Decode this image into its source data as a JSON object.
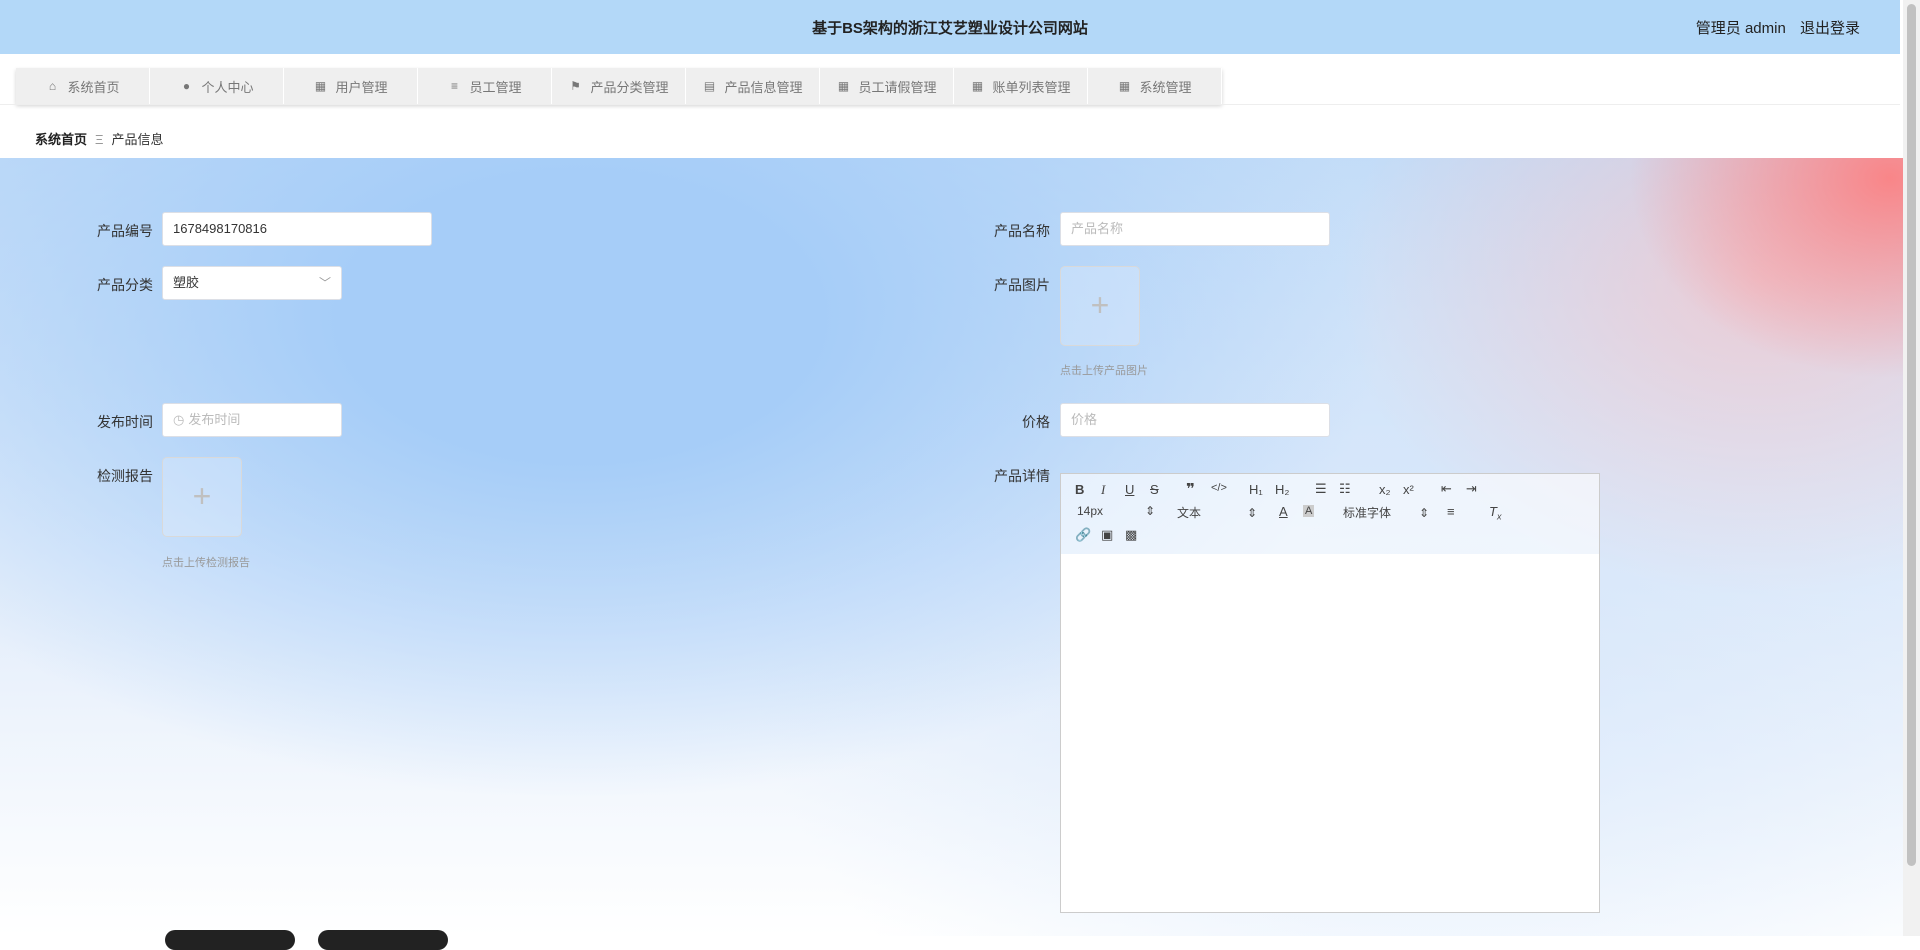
{
  "header": {
    "title": "基于BS架构的浙江艾艺塑业设计公司网站",
    "user_label": "管理员 admin",
    "logout": "退出登录"
  },
  "nav": [
    {
      "label": "系统首页",
      "icon": "home-icon"
    },
    {
      "label": "个人中心",
      "icon": "user-icon"
    },
    {
      "label": "用户管理",
      "icon": "grid-icon"
    },
    {
      "label": "员工管理",
      "icon": "list-icon"
    },
    {
      "label": "产品分类管理",
      "icon": "flag-icon"
    },
    {
      "label": "产品信息管理",
      "icon": "clipboard-icon"
    },
    {
      "label": "员工请假管理",
      "icon": "grid-icon"
    },
    {
      "label": "账单列表管理",
      "icon": "grid-icon"
    },
    {
      "label": "系统管理",
      "icon": "grid-icon"
    }
  ],
  "breadcrumb": {
    "home": "系统首页",
    "sep": "Ξ",
    "current": "产品信息"
  },
  "form": {
    "product_no_label": "产品编号",
    "product_no_value": "1678498170816",
    "product_name_label": "产品名称",
    "product_name_placeholder": "产品名称",
    "category_label": "产品分类",
    "category_value": "塑胶",
    "image_label": "产品图片",
    "image_hint": "点击上传产品图片",
    "publish_time_label": "发布时间",
    "publish_time_placeholder": "发布时间",
    "price_label": "价格",
    "price_placeholder": "价格",
    "report_label": "检测报告",
    "report_hint": "点击上传检测报告",
    "detail_label": "产品详情"
  },
  "editor": {
    "font_size": "14px",
    "heading": "文本",
    "font_family": "标准字体"
  }
}
